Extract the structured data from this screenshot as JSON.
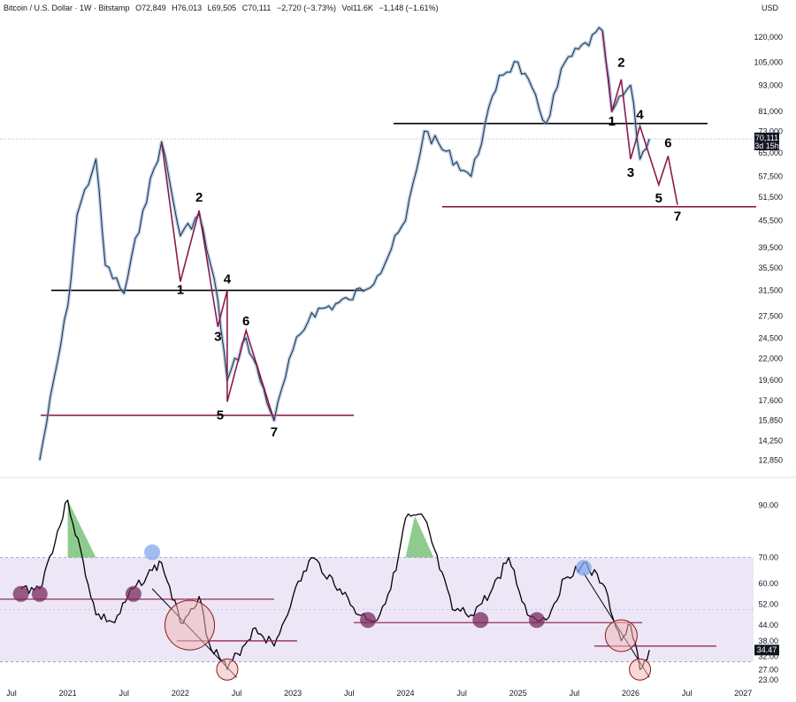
{
  "header": {
    "symbol": "Bitcoin / U.S. Dollar · 1W · Bitstamp",
    "open": "O72,849",
    "high": "H76,013",
    "low": "L69,505",
    "close": "C70,111",
    "change": "−2,720 (−3.73%)",
    "volume": "Vol11.6K",
    "volume_change": "−1,148 (−1.61%)"
  },
  "currency": "USD",
  "price_badge": {
    "price": "70,111",
    "countdown": "3d 15h"
  },
  "rsi_badge": "34.47",
  "chart_data": [
    {
      "type": "line",
      "title": "Bitcoin / U.S. Dollar",
      "scale": "log",
      "ylabel": "USD",
      "ytick_labels": [
        "120,000",
        "105,000",
        "93,000",
        "81,000",
        "73,000",
        "65,000",
        "57,500",
        "51,500",
        "45,500",
        "39,500",
        "35,500",
        "31,500",
        "27,500",
        "24,500",
        "22,000",
        "19,600",
        "17,600",
        "15,850",
        "14,250",
        "12,850"
      ],
      "xtick_labels": [
        "Jul",
        "2021",
        "Jul",
        "2022",
        "Jul",
        "2023",
        "Jul",
        "2024",
        "Jul",
        "2025",
        "Jul",
        "2026",
        "Jul",
        "2027"
      ],
      "x": [
        "2020-10",
        "2021-01",
        "2021-02",
        "2021-04",
        "2021-05",
        "2021-07",
        "2021-09",
        "2021-11",
        "2022-01",
        "2022-03",
        "2022-05",
        "2022-06",
        "2022-08",
        "2022-11",
        "2023-01",
        "2023-03",
        "2023-07",
        "2023-10",
        "2024-01",
        "2024-03",
        "2024-08",
        "2024-11",
        "2025-01",
        "2025-04",
        "2025-06",
        "2025-10",
        "2025-11",
        "2026-01",
        "2026-02",
        "2026-03"
      ],
      "series": [
        {
          "values": [
            12850,
            29000,
            47000,
            63000,
            36000,
            31000,
            48000,
            69000,
            42000,
            47000,
            30000,
            19600,
            24500,
            15850,
            23000,
            28000,
            30000,
            34000,
            45500,
            73000,
            57500,
            98000,
            105000,
            76000,
            105000,
            124000,
            81000,
            93000,
            63000,
            70111
          ]
        }
      ],
      "horizontal_levels": [
        {
          "value": 31500,
          "color": "#000000"
        },
        {
          "value": 16300,
          "color": "#8b1a4a"
        },
        {
          "value": 76000,
          "color": "#000000"
        },
        {
          "value": 49000,
          "color": "#8b1a4a"
        }
      ],
      "annotations": [
        "1",
        "2",
        "3",
        "4",
        "5",
        "6",
        "7",
        "1",
        "2",
        "3",
        "4",
        "5",
        "6",
        "7"
      ],
      "current_price": 70111,
      "ylim": [
        12300,
        128000
      ]
    },
    {
      "type": "line",
      "title": "RSI",
      "ytick_labels": [
        "90.00",
        "70.00",
        "60.00",
        "52.00",
        "44.00",
        "38.00",
        "32.00",
        "27.00",
        "23.00"
      ],
      "band": [
        30,
        70
      ],
      "x": [
        "2020-08",
        "2020-10",
        "2021-01",
        "2021-04",
        "2021-06",
        "2021-08",
        "2021-10",
        "2021-11",
        "2022-01",
        "2022-03",
        "2022-04",
        "2022-06",
        "2022-09",
        "2022-11",
        "2023-01",
        "2023-03",
        "2023-06",
        "2023-08",
        "2023-10",
        "2023-12",
        "2024-01",
        "2024-03",
        "2024-06",
        "2024-08",
        "2024-10",
        "2024-12",
        "2025-02",
        "2025-04",
        "2025-06",
        "2025-08",
        "2025-10",
        "2025-12",
        "2026-01",
        "2026-02",
        "2026-03"
      ],
      "series": [
        {
          "values": [
            58,
            58,
            92,
            48,
            45,
            58,
            65,
            68,
            45,
            55,
            38,
            27,
            43,
            36,
            55,
            70,
            58,
            48,
            46,
            65,
            85,
            85,
            50,
            48,
            56,
            70,
            48,
            46,
            62,
            68,
            60,
            38,
            44,
            27,
            34.47
          ]
        }
      ],
      "current_value": 34.47,
      "ylim": [
        22,
        98
      ]
    }
  ]
}
